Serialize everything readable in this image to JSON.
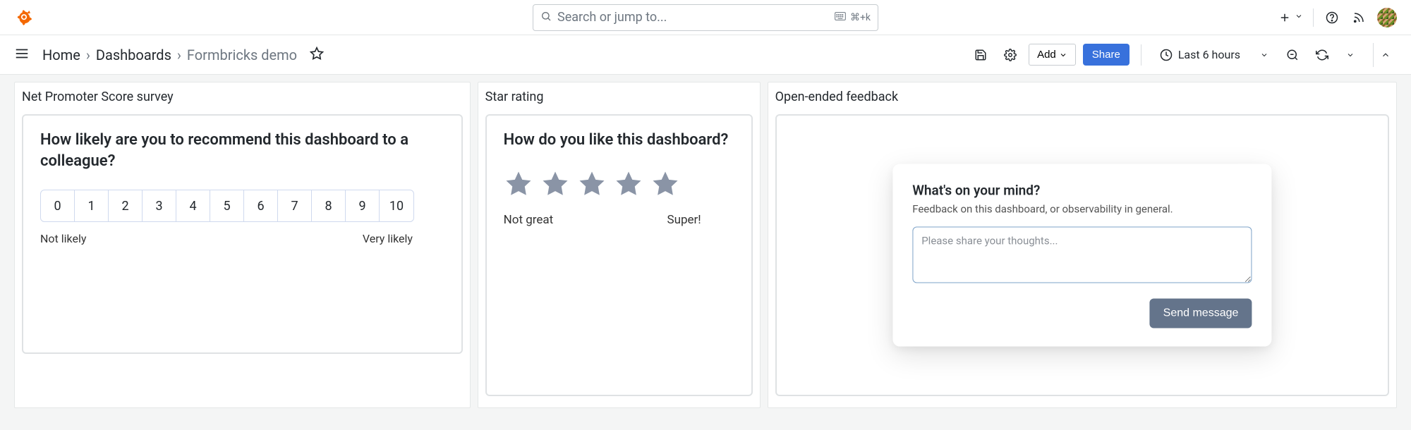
{
  "search": {
    "placeholder": "Search or jump to...",
    "shortcut": "⌘+k"
  },
  "breadcrumbs": {
    "home": "Home",
    "dashboards": "Dashboards",
    "current": "Formbricks demo"
  },
  "toolbar": {
    "add_label": "Add",
    "share_label": "Share",
    "time_label": "Last 6 hours"
  },
  "panels": {
    "nps": {
      "title": "Net Promoter Score survey",
      "question": "How likely are you to recommend this dashboard to a colleague?",
      "scale": [
        "0",
        "1",
        "2",
        "3",
        "4",
        "5",
        "6",
        "7",
        "8",
        "9",
        "10"
      ],
      "low_label": "Not likely",
      "high_label": "Very likely"
    },
    "star": {
      "title": "Star rating",
      "question": "How do you like this dashboard?",
      "low_label": "Not great",
      "high_label": "Super!"
    },
    "feedback": {
      "title": "Open-ended feedback",
      "card_title": "What's on your mind?",
      "card_subtitle": "Feedback on this dashboard, or observability in general.",
      "placeholder": "Please share your thoughts...",
      "button": "Send message"
    }
  }
}
